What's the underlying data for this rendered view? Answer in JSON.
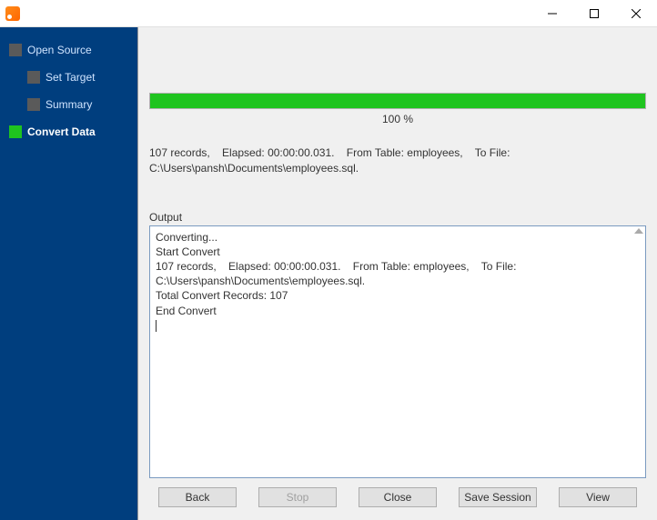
{
  "window": {
    "title": ""
  },
  "sidebar": {
    "items": [
      {
        "label": "Open Source",
        "level": 0,
        "active": false
      },
      {
        "label": "Set Target",
        "level": 1,
        "active": false
      },
      {
        "label": "Summary",
        "level": 1,
        "active": false
      },
      {
        "label": "Convert Data",
        "level": 0,
        "active": true
      }
    ]
  },
  "progress": {
    "percent_label": "100 %",
    "percent_value": 100
  },
  "summary_text": "107 records,    Elapsed: 00:00:00.031.    From Table: employees,    To File: C:\\Users\\pansh\\Documents\\employees.sql.",
  "output": {
    "label": "Output",
    "text": "Converting...\nStart Convert\n107 records,    Elapsed: 00:00:00.031.    From Table: employees,    To File: C:\\Users\\pansh\\Documents\\employees.sql.\nTotal Convert Records: 107\nEnd Convert"
  },
  "buttons": {
    "back": "Back",
    "stop": "Stop",
    "close": "Close",
    "save_session": "Save Session",
    "view": "View"
  }
}
